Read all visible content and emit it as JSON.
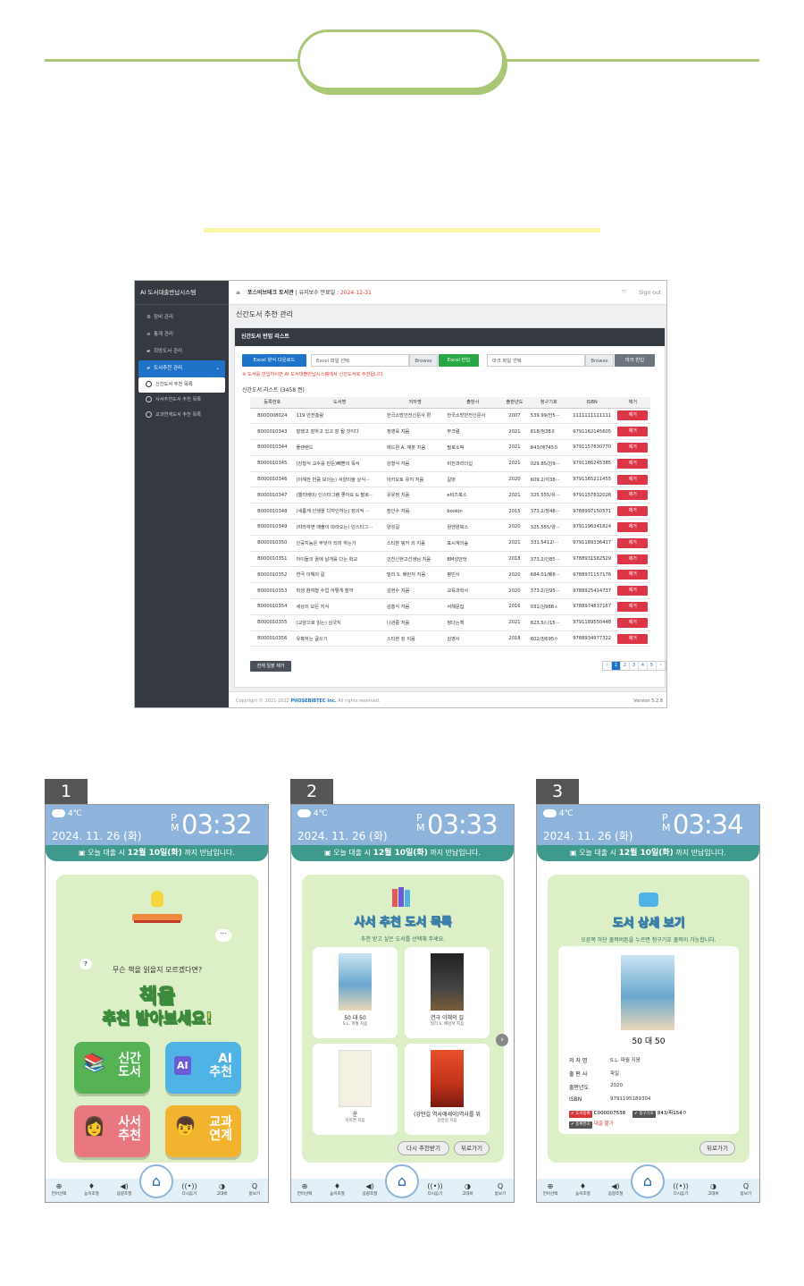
{
  "admin": {
    "app_title": "AI 도서대출반납시스템",
    "menu": [
      {
        "icon": "gear-icon",
        "glyph": "⚙",
        "label": "장비 관리"
      },
      {
        "icon": "chart-icon",
        "glyph": "≌",
        "label": "통계 관리"
      },
      {
        "icon": "book-icon",
        "glyph": "▰",
        "label": "희망도서 관리"
      },
      {
        "icon": "book-icon",
        "glyph": "▰",
        "label": "도서추천 관리"
      }
    ],
    "submenu": [
      "신간도서 추천 목록",
      "사서추천도서 추천 목록",
      "교과연계도서 추천 목록"
    ],
    "topbar": {
      "menu_glyph": "≡",
      "company": "포스비브테크 도서관",
      "maint_label": "| 유지보수 만료일 :",
      "maint_date": "2024-12-31",
      "signout": "Sign out"
    },
    "page_title": "신간도서 추천 관리",
    "card_title": "신간도서 반입 리스트",
    "buttons": {
      "excel_download": "Excel 양식 다운로드",
      "excel_file_placeholder": "Excel 파일 선택",
      "browse": "Browse",
      "excel_import": "Excel 반입",
      "marc_file_placeholder": "마크 파일 선택",
      "marc_import": "마크 반입",
      "delete_all": "전체 일괄 제거"
    },
    "notice": "※ 도서를 반입하시면 AI 도서대출반납시스템에서 신간도서로 추천됩니다.",
    "count_label": "신간도서 리스트 (3458 권)",
    "columns": [
      "등록번호",
      "도서명",
      "저자명",
      "출판사",
      "출판년도",
      "청구기호",
      "ISBN",
      "제거"
    ],
    "rows": [
      [
        "B000008024",
        "119 안전총람",
        "한국소방안전신문사 편",
        "한국소방안전신문사",
        "2007",
        "539.99/한5···",
        "1111111111111",
        "제거"
      ],
      [
        "B000010343",
        "잘했고 잘하고 있고 잘 될 것이다",
        "정영욱 지음",
        "부크럼",
        "2021",
        "818/정38ㅍ",
        "9791162145605",
        "제거"
      ],
      [
        "B000010344",
        "플랜랜드",
        "에드윈 A. 애봇 지음",
        "필로소픽",
        "2021",
        "843/애745ㅍ",
        "9791157830770",
        "제거"
      ],
      [
        "B000010345",
        "(강형식 교수를 만든)빼빤의 독서",
        "강형식 지음",
        "비전과리더십",
        "2021",
        "029.85/강9···",
        "9791186245385",
        "제거"
      ],
      [
        "B000010346",
        "(이해한 만큼 보이는) 서양미술 상식···",
        "아키모토 유지 지음",
        "길벗",
        "2020",
        "609.2/야38···",
        "9791165211455",
        "제거"
      ],
      [
        "B000010347",
        "(엘리베이) 인스타그램 좋아요 & 팔로···",
        "유유정 지음",
        "e비즈북스",
        "2021",
        "325.555/유···",
        "9791157832026",
        "제거"
      ],
      [
        "B000010348",
        "(새롭게 인생을 디자인하는) 장의적 ···",
        "장인수 지음",
        "bookin",
        "2015",
        "373.2/장48···",
        "9788997150571",
        "제거"
      ],
      [
        "B000010349",
        "(따라하면 매출이 따라오는) 인스타그···",
        "양성길",
        "원앤원북스",
        "2020",
        "325.555/양···",
        "9791196341824",
        "제거"
      ],
      [
        "B000010350",
        "인공지능은 무엇이 되려 하는가",
        "스티븐 핑커 외 지음",
        "표시계의숲",
        "2021",
        "331.5412/···",
        "9791189336417",
        "제거"
      ],
      [
        "B000010351",
        "아이들의 꿈에 날개를 다는 학교",
        "인천신현고선생님 지음",
        "BM성안당",
        "2018",
        "373.2/인85···",
        "9788931582529",
        "제거"
      ],
      [
        "B000010352",
        "연극 이해의 길",
        "밀리 S. 배런저 지음",
        "평민사",
        "2020",
        "684.01/배8···",
        "9788971157176",
        "제거"
      ],
      [
        "B000010353",
        "학생 참여형 수업 어떻게 할까",
        "김현수 지음",
        "교육과학사",
        "2020",
        "373.2/김95···",
        "9788925414737",
        "제거"
      ],
      [
        "B000010354",
        "세상의 모든 지식",
        "김흥식 지음",
        "서해문집",
        "2016",
        "031/김988ㅅ",
        "9788974837167",
        "제거"
      ],
      [
        "B000010355",
        "(교양으로 읽는) 삼국지",
        "나관중 지음",
        "정다는책",
        "2021",
        "823.5/나15···",
        "9791189550448",
        "제거"
      ],
      [
        "B000010356",
        "유혹하는 글쓰기",
        "스티븐 킹 지음",
        "김영사",
        "2018",
        "802/킹695ㅇ",
        "9788934977322",
        "제거"
      ]
    ],
    "pager": [
      "‹",
      "1",
      "2",
      "3",
      "4",
      "5",
      "›"
    ],
    "footer": {
      "copyright": "Copyright © 2021-2022",
      "company": "PHOSEBIBTEC Inc.",
      "rights": "All rights reserved.",
      "version": "Version 5.2.8"
    }
  },
  "kiosks": [
    {
      "num": "1",
      "temp": "4℃",
      "date": "2024. 11. 26 (화)",
      "time": "03:32"
    },
    {
      "num": "2",
      "temp": "4℃",
      "date": "2024. 11. 26 (화)",
      "time": "03:33"
    },
    {
      "num": "3",
      "temp": "4℃",
      "date": "2024. 11. 26 (화)",
      "time": "03:34"
    }
  ],
  "kiosk_common": {
    "ampm_p": "P",
    "ampm_m": "M",
    "return_notice_pre": "오늘 대출 시 ",
    "return_date": "12월 10일(화)",
    "return_notice_post": " 까지 반납입니다.",
    "nav": [
      "언어선택",
      "높이조절",
      "음량조절",
      "홈",
      "다시듣기",
      "고대비",
      "돋보기"
    ],
    "nav_glyphs": [
      "⊕",
      "♦",
      "◀)",
      "⌂",
      "((•))",
      "◑",
      "Q"
    ]
  },
  "kiosk1": {
    "question": "무슨 책을 읽을지 모르겠다면?",
    "big1": "책을",
    "big2": "추천 받아보세요!",
    "buttons": [
      {
        "label1": "신간",
        "label2": "도서",
        "color": "#55b356",
        "icon": "books-icon",
        "glyph": "📚"
      },
      {
        "label1": "AI",
        "label2": "추천",
        "color": "#4fb3e5",
        "icon": "ai-chip-icon",
        "glyph": "AI"
      },
      {
        "label1": "사서",
        "label2": "추천",
        "color": "#e8777f",
        "icon": "librarian-icon",
        "glyph": "👩"
      },
      {
        "label1": "교과",
        "label2": "연계",
        "color": "#f2b42e",
        "icon": "student-icon",
        "glyph": "👦"
      }
    ]
  },
  "kiosk2": {
    "title": "사서 추천 도서 목록",
    "subtitle": "추천 받고 싶은 도서를 선택해 주세요.",
    "books": [
      {
        "title": "50 대 50",
        "author": "S.L. 파월 지음"
      },
      {
        "title": "연극 이해의 길",
        "author": "밀리 S. 배런저 지음"
      },
      {
        "title": "운",
        "author": "이지연 지음"
      },
      {
        "title": "(강만길 역사에세이)역사를 위",
        "author": "강만길 지음"
      }
    ],
    "btn_again": "다시 추천받기",
    "btn_back": "뒤로가기"
  },
  "kiosk3": {
    "title": "도서 상세 보기",
    "subtitle": "오른쪽 하단 출력버튼을 누르면 청구기호 출력이 가능합니다.",
    "book_title": "50 대 50",
    "labels": {
      "author": "저 자 명",
      "publisher": "출 판 사",
      "year": "출판년도",
      "isbn": "ISBN"
    },
    "values": {
      "author": "S.L. 파월 지음",
      "publisher": "파일",
      "year": "2020",
      "isbn": "9791195189304"
    },
    "tags": {
      "reg_label": "✔ 도서등록",
      "reg_value": "C000007538",
      "call_label": "✔ 청구기호",
      "call_value": "843/파154ㅇ",
      "status_label": "✔ 등록번호",
      "status_value": "대출 불가"
    },
    "btn_back": "뒤로가기"
  }
}
